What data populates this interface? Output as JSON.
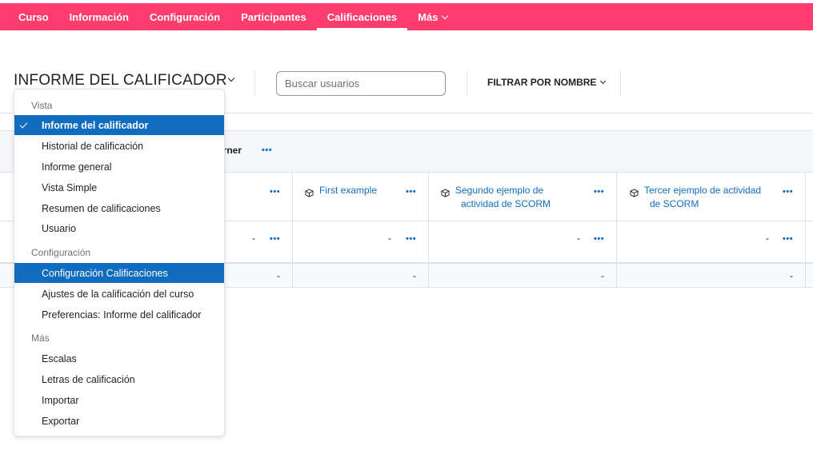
{
  "nav": {
    "items": [
      {
        "label": "Curso",
        "active": false
      },
      {
        "label": "Información",
        "active": false
      },
      {
        "label": "Configuración",
        "active": false
      },
      {
        "label": "Participantes",
        "active": false
      },
      {
        "label": "Calificaciones",
        "active": true
      },
      {
        "label": "Más",
        "active": false
      }
    ],
    "bg_color": "#ff3c6e"
  },
  "header": {
    "title": "INFORME DEL CALIFICADOR",
    "search_placeholder": "Buscar usuarios",
    "filter_label": "FILTRAR POR NOMBRE"
  },
  "grader": {
    "course_label": "arner",
    "activities": [
      {
        "line1": "First example",
        "line2": ""
      },
      {
        "line1": "Segundo ejemplo de",
        "line2": "actividad de SCORM"
      },
      {
        "line1": "Tercer ejemplo de actividad",
        "line2": "de SCORM"
      }
    ],
    "dash": "-",
    "menu_dots": "•••",
    "accent_color": "#0f6cbf"
  },
  "dropdown": {
    "sections": [
      {
        "header": "Vista",
        "items": [
          {
            "label": "Informe del calificador",
            "active": true
          },
          {
            "label": "Historial de calificación",
            "active": false
          },
          {
            "label": "Informe general",
            "active": false
          },
          {
            "label": "Vista Simple",
            "active": false
          },
          {
            "label": "Resumen de calificaciones",
            "active": false
          },
          {
            "label": "Usuario",
            "active": false
          }
        ]
      },
      {
        "header": "Configuración",
        "items": [
          {
            "label": "Configuración Calificaciones",
            "active": true
          },
          {
            "label": "Ajustes de la calificación del curso",
            "active": false
          },
          {
            "label": "Preferencias: Informe del calificador",
            "active": false
          }
        ]
      },
      {
        "header": "Más",
        "items": [
          {
            "label": "Escalas",
            "active": false
          },
          {
            "label": "Letras de calificación",
            "active": false
          },
          {
            "label": "Importar",
            "active": false
          },
          {
            "label": "Exportar",
            "active": false
          }
        ]
      }
    ]
  }
}
